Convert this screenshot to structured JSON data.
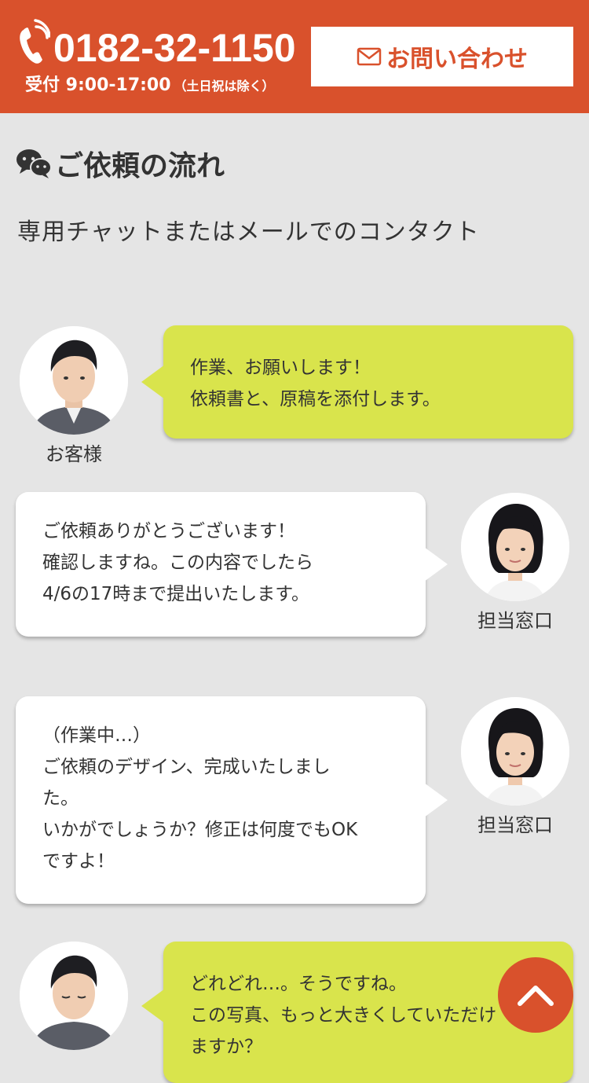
{
  "header": {
    "phone_number": "0182-32-1150",
    "hours_label": "受付 9:00-17:00",
    "hours_note": "（土日祝は除く）",
    "contact_button": "お問い合わせ",
    "brand_color": "#d9512c"
  },
  "section": {
    "title": "ご依頼の流れ",
    "title_icon": "chat-bubbles-icon",
    "subtitle": "専用チャットまたはメールでのコンタクト"
  },
  "labels": {
    "customer": "お客様",
    "staff": "担当窓口"
  },
  "messages": [
    {
      "speaker": "customer",
      "lines": [
        "作業、お願いします！",
        "依頼書と、原稿を添付します。"
      ]
    },
    {
      "speaker": "staff",
      "lines": [
        "ご依頼ありがとうございます！",
        "確認しますね。この内容でしたら",
        "4/6の17時まで提出いたします。"
      ]
    },
    {
      "speaker": "staff",
      "lines": [
        "（作業中…）",
        "ご依頼のデザイン、完成いたしまし",
        "た。",
        "いかがでしょうか？修正は何度でもOK",
        "ですよ！"
      ]
    },
    {
      "speaker": "customer",
      "lines": [
        "どれどれ…。そうですね。",
        "この写真、もっと大きくしていただけ",
        "ますか？"
      ]
    }
  ],
  "colors": {
    "customer_bubble": "#d9e44c",
    "staff_bubble": "#ffffff",
    "background": "#e5e5e5"
  },
  "scroll_top_icon": "chevron-up-icon"
}
